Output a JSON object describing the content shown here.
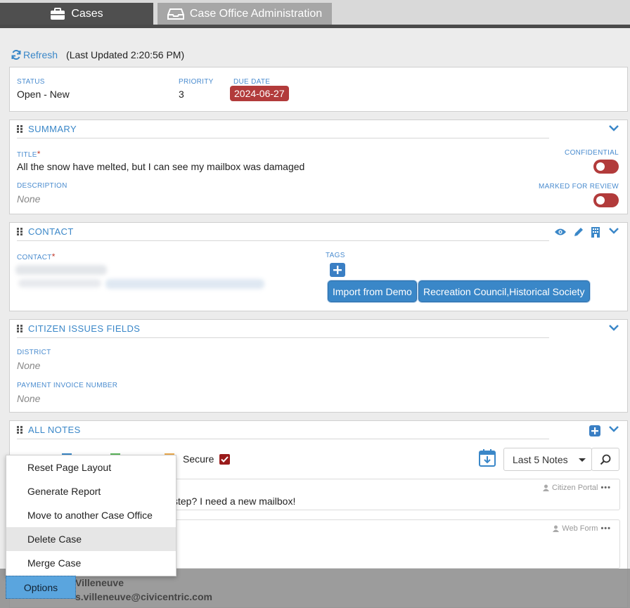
{
  "tabs": [
    {
      "label": "Cases",
      "active": true
    },
    {
      "label": "Case Office Administration",
      "active": false
    }
  ],
  "refresh": {
    "label": "Refresh",
    "last_updated": "(Last Updated 2:20:56 PM)"
  },
  "status_panel": {
    "status_label": "STATUS",
    "status_value": "Open - New",
    "priority_label": "PRIORITY",
    "priority_value": "3",
    "due_label": "DUE DATE",
    "due_value": "2024-06-27"
  },
  "summary": {
    "title": "SUMMARY",
    "title_label": "TITLE",
    "title_value": "All the snow have melted, but I can see my mailbox was damaged",
    "description_label": "DESCRIPTION",
    "description_value": "None",
    "confidential_label": "CONFIDENTIAL",
    "confidential_on": false,
    "review_label": "MARKED FOR REVIEW",
    "review_on": false
  },
  "contact": {
    "title": "CONTACT",
    "contact_label": "CONTACT",
    "tags_label": "TAGS",
    "tags": [
      "Import from Demo",
      "Recreation Council,Historical Society"
    ]
  },
  "citizen": {
    "title": "CITIZEN ISSUES FIELDS",
    "district_label": "DISTRICT",
    "district_value": "None",
    "invoice_label": "PAYMENT INVOICE NUMBER",
    "invoice_value": "None"
  },
  "notes": {
    "title": "ALL NOTES",
    "secure_label": "Secure",
    "last_notes": "Last 5 Notes",
    "items": [
      {
        "source": "Citizen Portal",
        "text": "step? I need a new mailbox!"
      },
      {
        "source": "Web Form",
        "text": ""
      }
    ]
  },
  "menu": {
    "items": [
      "Reset Page Layout",
      "Generate Report",
      "Move to another Case Office",
      "Delete Case",
      "Merge Case"
    ],
    "highlighted": "Delete Case"
  },
  "bottom": {
    "name_fragment": "Villeneuve",
    "email_fragment": "s.villeneuve@civicentric.com"
  },
  "options_label": "Options",
  "colors": {
    "accent": "#3a87c8",
    "danger": "#b23b3b",
    "tab_active": "#4f4f4f",
    "tab_inactive": "#a6a6a6"
  }
}
